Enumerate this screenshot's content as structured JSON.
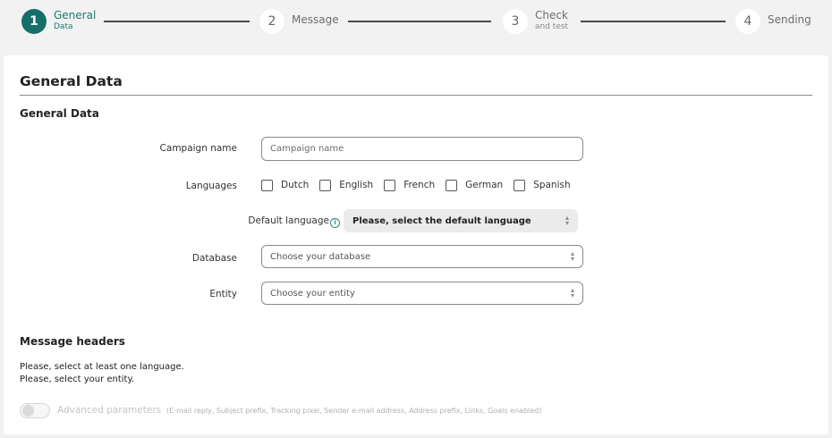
{
  "stepper": {
    "steps": [
      {
        "number": "1",
        "label": "General",
        "sublabel": "Data",
        "active": true
      },
      {
        "number": "2",
        "label": "Message",
        "sublabel": "",
        "active": false
      },
      {
        "number": "3",
        "label": "Check",
        "sublabel": "and test",
        "active": false
      },
      {
        "number": "4",
        "label": "Sending",
        "sublabel": "",
        "active": false
      }
    ]
  },
  "page": {
    "title": "General Data",
    "section_general": "General Data",
    "section_headers": "Message headers"
  },
  "form": {
    "campaign_name": {
      "label": "Campaign name",
      "placeholder": "Campaign name",
      "value": ""
    },
    "languages": {
      "label": "Languages",
      "options": [
        "Dutch",
        "English",
        "French",
        "German",
        "Spanish"
      ]
    },
    "default_language": {
      "label": "Default language",
      "value": "Please, select the default language",
      "info_icon": "info-icon"
    },
    "database": {
      "label": "Database",
      "value": "Choose your database"
    },
    "entity": {
      "label": "Entity",
      "value": "Choose your entity"
    }
  },
  "notices": {
    "line1": "Please, select at least one language.",
    "line2": "Please, select your entity."
  },
  "advanced": {
    "label": "Advanced parameters",
    "detail": "(E-mail reply, Subject prefix, Tracking pixel, Sender e-mail address, Address prefix, Links, Goals enabled)",
    "enabled": false
  },
  "colors": {
    "accent": "#176e69",
    "background": "#f1f2f1"
  }
}
